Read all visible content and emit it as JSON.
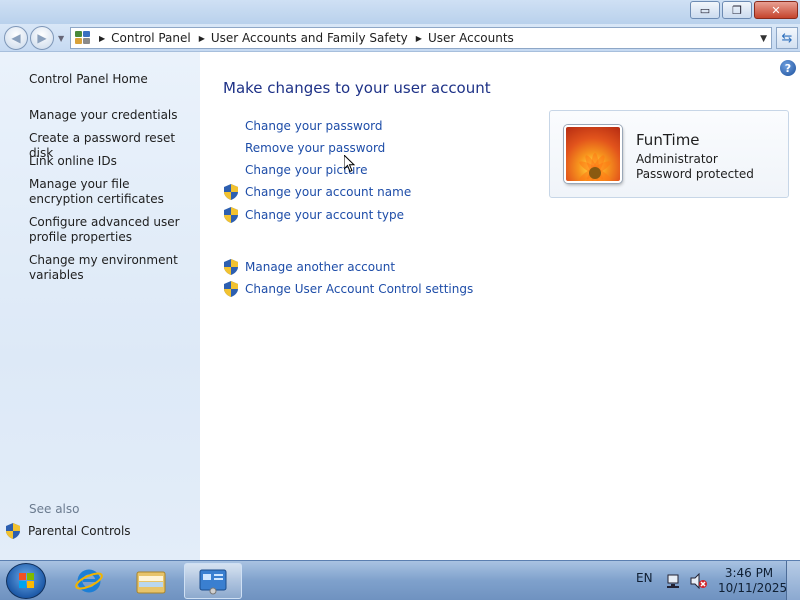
{
  "window": {
    "buttons": {
      "minimize": "▭",
      "maximize": "❐",
      "close": "✕"
    }
  },
  "address_bar": {
    "crumbs": [
      "Control Panel",
      "User Accounts and Family Safety",
      "User Accounts"
    ]
  },
  "left_pane": {
    "home": "Control Panel Home",
    "tasks": [
      "Manage your credentials",
      "Create a password reset disk",
      "Link online IDs",
      "Manage your file encryption certificates",
      "Configure advanced user profile properties",
      "Change my environment variables"
    ],
    "see_also": "See also",
    "parental_controls": "Parental Controls"
  },
  "main": {
    "heading": "Make changes to your user account",
    "links": [
      "Change your password",
      "Remove your password",
      "Change your picture",
      "Change your account name",
      "Change your account type"
    ],
    "other_links": [
      "Manage another account",
      "Change User Account Control settings"
    ]
  },
  "user_card": {
    "name": "FunTime",
    "role": "Administrator",
    "status": "Password protected"
  },
  "taskbar": {
    "language": "EN",
    "time": "3:46 PM",
    "date": "10/11/2025"
  }
}
